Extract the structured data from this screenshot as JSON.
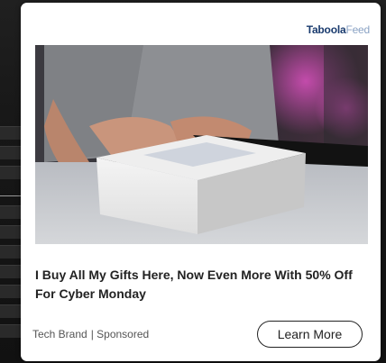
{
  "ad": {
    "brand_main": "Taboola",
    "brand_sub": "Feed",
    "headline": "I Buy All My Gifts Here, Now Even More With 50% Off For Cyber Monday",
    "advertiser": "Tech Brand",
    "sponsored_label": "| Sponsored",
    "cta_label": "Learn More",
    "image_subject": "hands-opening-white-gift-box-photo"
  },
  "colors": {
    "brand_dark": "#1a3b6e",
    "brand_light": "#8aa2c4",
    "card_bg": "#ffffff",
    "page_bg": "#1c1c1c"
  }
}
